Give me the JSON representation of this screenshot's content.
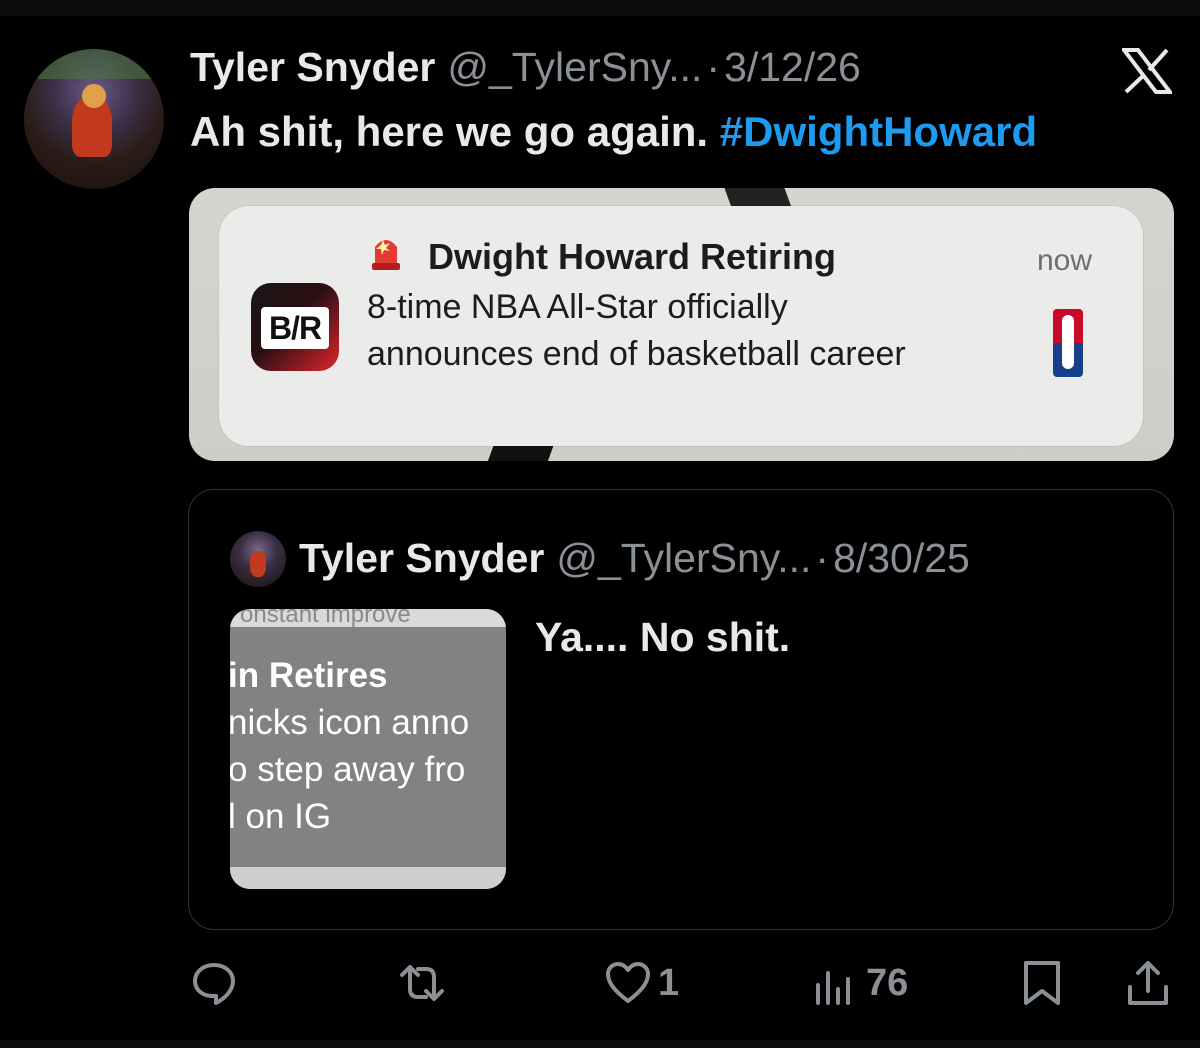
{
  "tweet": {
    "author_name": "Tyler Snyder",
    "handle": "@_TylerSny...",
    "separator": "·",
    "date": "3/12/26",
    "text": "Ah shit, here we go again. ",
    "hashtag": "#DwightHoward",
    "platform_icon": "x-logo-icon"
  },
  "notification": {
    "app_logo_text": "B/R",
    "title": "Dwight Howard Retiring",
    "body": "8-time NBA All-Star officially announces end of basketball career",
    "time": "now",
    "alert_icon": "siren-icon",
    "league_icon": "nba-logo-icon"
  },
  "quoted_tweet": {
    "author_name": "Tyler Snyder",
    "handle": "@_TylerSny...",
    "separator": "·",
    "date": "8/30/25",
    "text": "Ya.... No shit.",
    "media": {
      "top_strip_text": "onstant improve",
      "title": "in Retires",
      "line1": "nicks icon anno",
      "line2": "o step away fro",
      "line3": "l on IG"
    }
  },
  "actions": {
    "reply_icon": "reply-icon",
    "retweet_icon": "retweet-icon",
    "like_icon": "heart-icon",
    "like_count": "1",
    "views_icon": "views-icon",
    "view_count": "76",
    "bookmark_icon": "bookmark-icon",
    "share_icon": "share-icon"
  },
  "colors": {
    "background": "#000000",
    "text": "#e7e9ea",
    "muted": "#8b9096",
    "link": "#1d9bf0"
  }
}
